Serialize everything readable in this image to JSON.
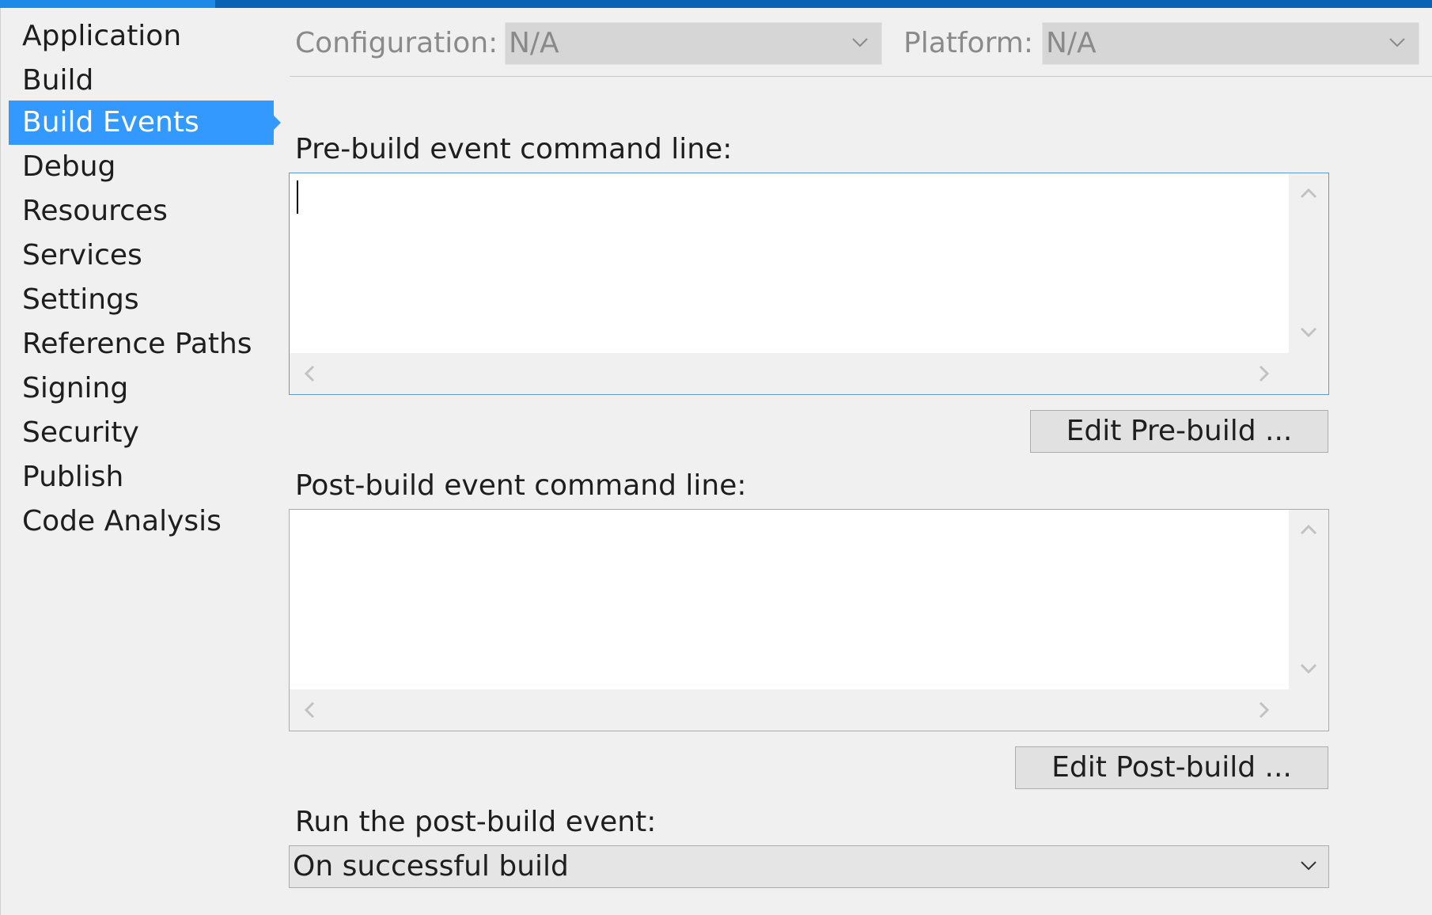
{
  "sidebar": {
    "items": [
      {
        "label": "Application"
      },
      {
        "label": "Build"
      },
      {
        "label": "Build Events",
        "selected": true
      },
      {
        "label": "Debug"
      },
      {
        "label": "Resources"
      },
      {
        "label": "Services"
      },
      {
        "label": "Settings"
      },
      {
        "label": "Reference Paths"
      },
      {
        "label": "Signing"
      },
      {
        "label": "Security"
      },
      {
        "label": "Publish"
      },
      {
        "label": "Code Analysis"
      }
    ]
  },
  "config": {
    "configuration_label": "Configuration:",
    "configuration_value": "N/A",
    "platform_label": "Platform:",
    "platform_value": "N/A"
  },
  "pre_build": {
    "label": "Pre-build event command line:",
    "value": "",
    "edit_button": "Edit Pre-build ..."
  },
  "post_build": {
    "label": "Post-build event command line:",
    "value": "",
    "edit_button": "Edit Post-build ..."
  },
  "run_post_build": {
    "label": "Run the post-build event:",
    "selected": "On successful build"
  },
  "colors": {
    "selection": "#3399ff",
    "title_bar": "#0a62b5",
    "focus_border": "#5b9bd5"
  }
}
